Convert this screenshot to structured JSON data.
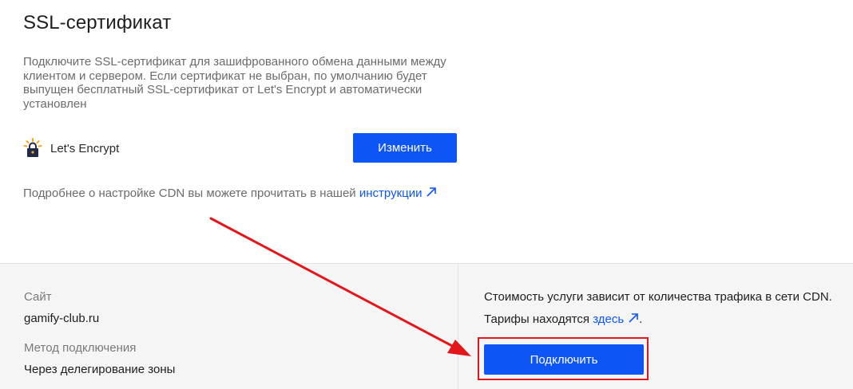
{
  "ssl": {
    "title": "SSL-сертификат",
    "description": "Подключите SSL-сертификат для зашифрованного обмена данными между клиентом и сервером. Если сертификат не выбран, по умолчанию будет выпущен бесплатный SSL-сертификат от Let's Encrypt и автоматически установлен",
    "certificate_name": "Let's Encrypt",
    "change_button": "Изменить",
    "more_text": "Подробнее о настройке CDN вы можете прочитать в нашей ",
    "more_link": "инструкции"
  },
  "summary": {
    "site_label": "Сайт",
    "site_value": "gamify-club.ru",
    "method_label": "Метод подключения",
    "method_value": "Через делегирование зоны"
  },
  "pricing": {
    "cost_text": "Стоимость услуги зависит от количества трафика в сети CDN.",
    "tariffs_text": "Тарифы находятся ",
    "tariffs_link": "здесь",
    "tariffs_suffix": ".",
    "connect_button": "Подключить"
  },
  "colors": {
    "accent": "#0d55f5",
    "annotation": "#e3161b",
    "footer_bg": "#f5f5f6"
  },
  "icons": {
    "certificate": "padlock-sun-icon",
    "external": "external-link-arrow-icon"
  }
}
